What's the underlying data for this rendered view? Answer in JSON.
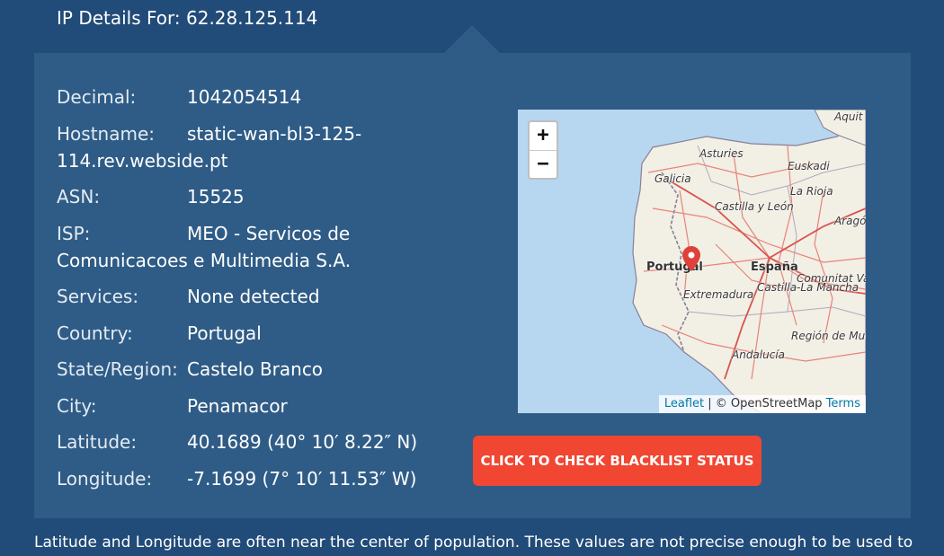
{
  "header": {
    "title": "IP Details For: 62.28.125.114"
  },
  "details": [
    {
      "label": "Decimal:",
      "value": "1042054514"
    },
    {
      "label": "Hostname:",
      "value": "static-wan-bl3-125-114.rev.webside.pt"
    },
    {
      "label": "ASN:",
      "value": "15525"
    },
    {
      "label": "ISP:",
      "value": "MEO - Servicos de Comunicacoes e Multimedia S.A."
    },
    {
      "label": "Services:",
      "value": "None detected"
    },
    {
      "label": "Country:",
      "value": "Portugal"
    },
    {
      "label": "State/Region:",
      "value": "Castelo Branco"
    },
    {
      "label": "City:",
      "value": "Penamacor"
    },
    {
      "label": "Latitude:",
      "value": "40.1689 (40° 10′ 8.22″ N)"
    },
    {
      "label": "Longitude:",
      "value": "-7.1699 (7° 10′ 11.53″ W)"
    }
  ],
  "map": {
    "zoom_in": "+",
    "zoom_out": "−",
    "attribution_leaflet": "Leaflet",
    "attribution_sep": " | © OpenStreetMap ",
    "attribution_terms": "Terms",
    "labels": {
      "aquitaine": "Aquit",
      "asturies": "Asturies",
      "euskadi": "Euskadi",
      "galicia": "Galicia",
      "la_rioja": "La Rioja",
      "aragon": "Aragó",
      "castilla_leon": "Castilla y León",
      "portugal": "Portugal",
      "espana": "España",
      "comunitat": "Comunitat Va",
      "castilla_mancha": "Castilla-La Mancha",
      "extremadura": "Extremadura",
      "region_murcia": "Región de Mur",
      "andalucia": "Andalucía"
    },
    "colors": {
      "water": "#b7d6ef",
      "land": "#f2efe4",
      "road": "#e8837a",
      "border": "#8a7f9a"
    }
  },
  "actions": {
    "blacklist_label": "CLICK TO CHECK BLACKLIST STATUS"
  },
  "footnote": "Latitude and Longitude are often near the center of population. These values are not precise enough to be used to"
}
